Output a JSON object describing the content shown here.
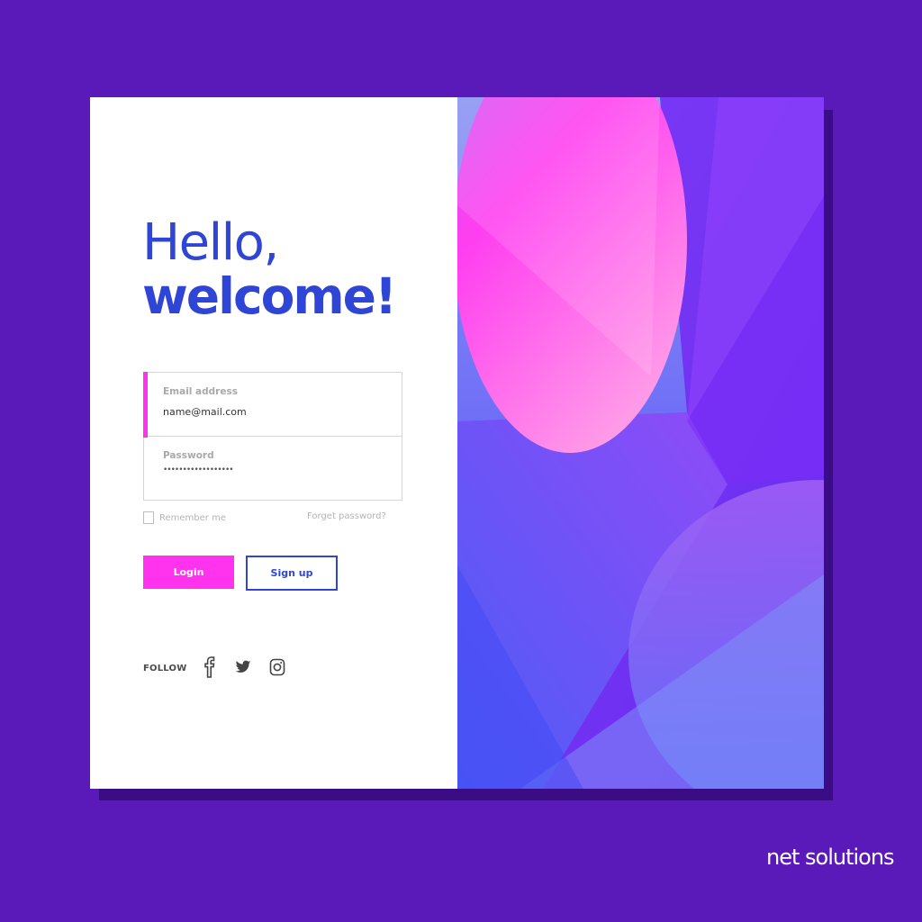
{
  "colors": {
    "page_background": "#5a1ab9",
    "heading": "#2f45d6",
    "accent_pink": "#ff33ee",
    "panel": "#ffffff"
  },
  "heading": {
    "line1": "Hello,",
    "line2": "welcome!"
  },
  "form": {
    "email_label": "Email address",
    "email_value": "name@mail.com",
    "password_label": "Password",
    "password_value": "••••••••••••••••••",
    "remember_label": "Remember me",
    "forgot_label": "Forget password?"
  },
  "buttons": {
    "login": "Login",
    "signup": "Sign up"
  },
  "follow": {
    "label": "FOLLOW",
    "icons": [
      "facebook-icon",
      "twitter-icon",
      "instagram-icon"
    ]
  },
  "brand": {
    "logo_text": "net solutions"
  }
}
